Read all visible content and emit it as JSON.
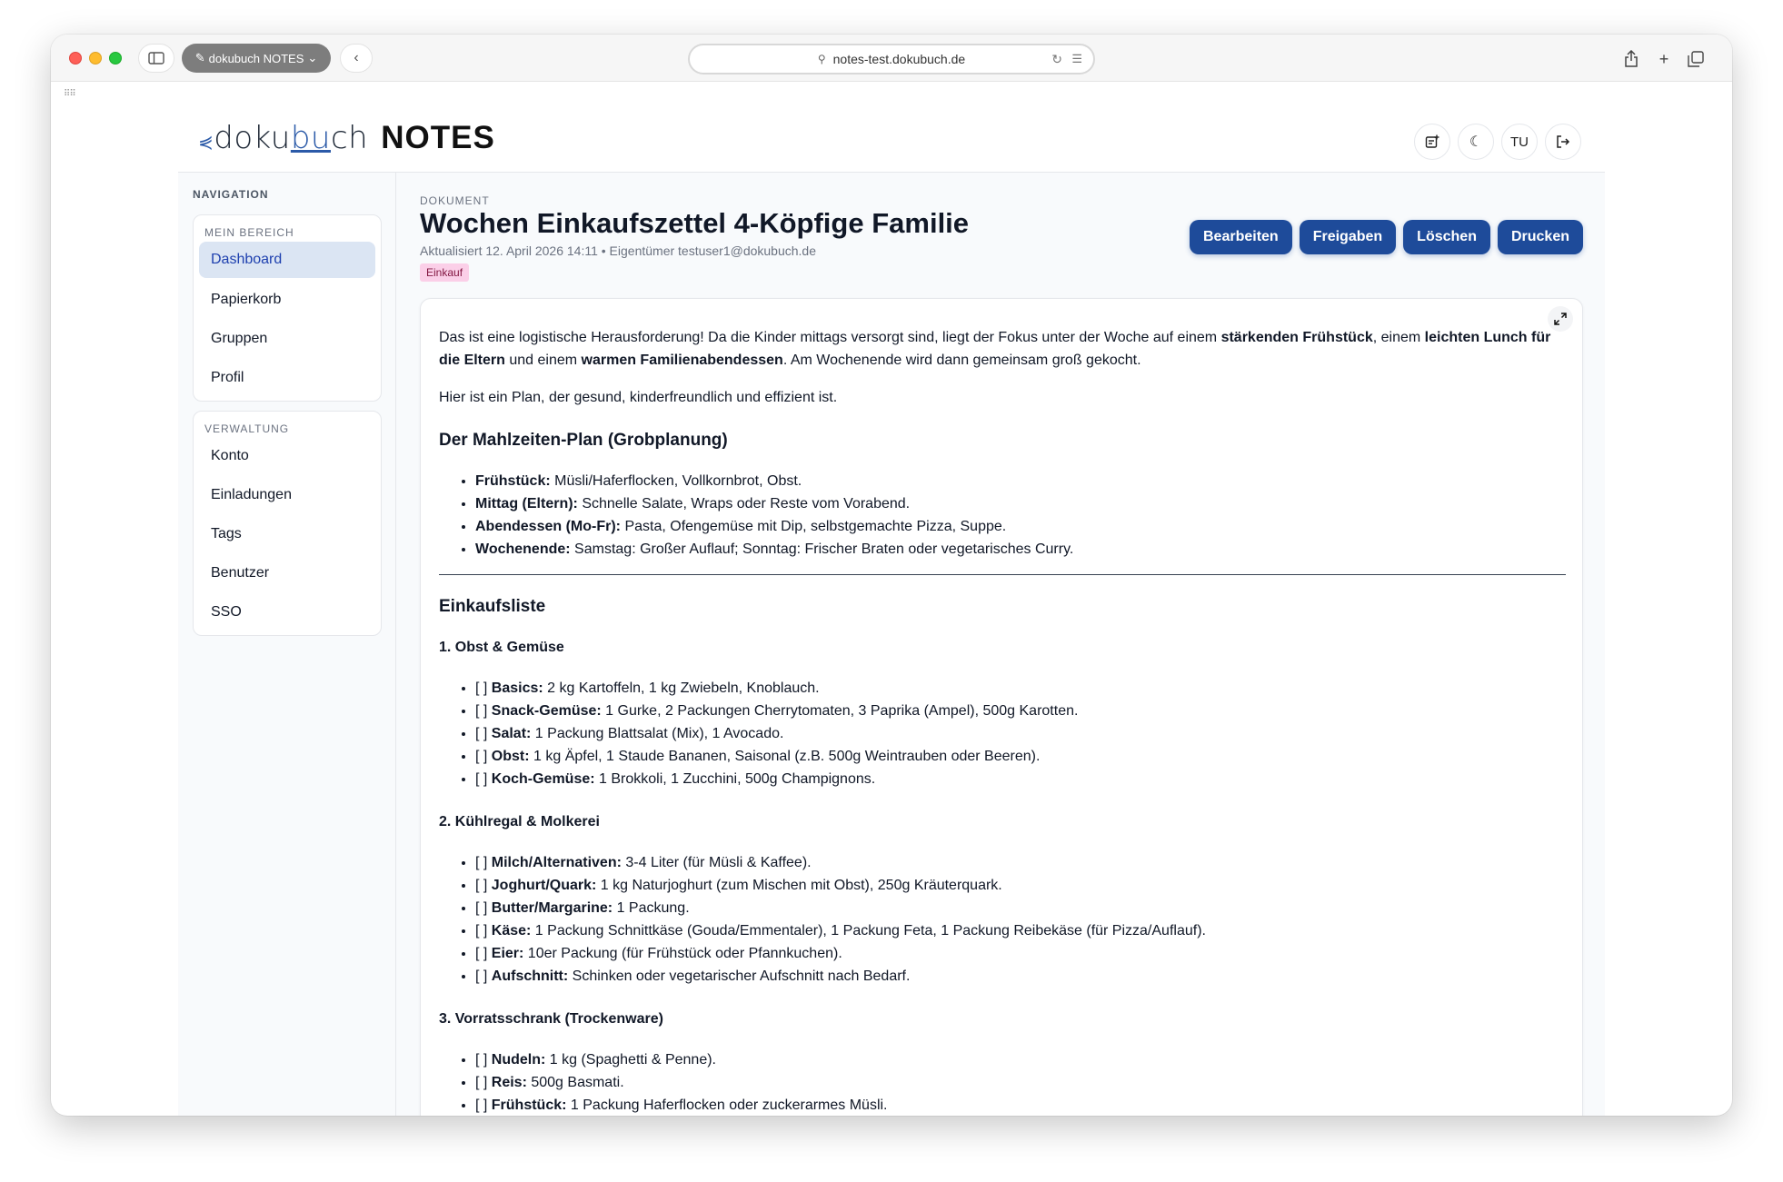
{
  "browser": {
    "tab_group_label": "dokubuch NOTES",
    "url": "notes-test.dokubuch.de"
  },
  "header": {
    "logo_text_pre": "doku",
    "logo_text_mid": "bu",
    "logo_text_post": "ch",
    "logo_product": "NOTES",
    "user_initials": "TU"
  },
  "nav": {
    "title": "NAVIGATION",
    "group1_label": "MEIN BEREICH",
    "group1_items": [
      "Dashboard",
      "Papierkorb",
      "Gruppen",
      "Profil"
    ],
    "group2_label": "VERWALTUNG",
    "group2_items": [
      "Konto",
      "Einladungen",
      "Tags",
      "Benutzer",
      "SSO"
    ]
  },
  "document": {
    "kicker": "DOKUMENT",
    "title": "Wochen Einkaufszettel 4-Köpfige Familie",
    "meta": "Aktualisiert 12. April 2026 14:11 • Eigentümer testuser1@dokubuch.de",
    "tag": "Einkauf",
    "actions": [
      "Bearbeiten",
      "Freigaben",
      "Löschen",
      "Drucken"
    ]
  },
  "content": {
    "intro_a": "Das ist eine logistische Herausforderung! Da die Kinder mittags versorgt sind, liegt der Fokus unter der Woche auf einem ",
    "intro_b": "stärkenden Frühstück",
    "intro_c": ", einem ",
    "intro_d": "leichten Lunch für die Eltern",
    "intro_e": " und einem ",
    "intro_f": "warmen Familienabendessen",
    "intro_g": ". Am Wochenende wird dann gemeinsam groß gekocht.",
    "plan_intro": "Hier ist ein Plan, der gesund, kinderfreundlich und effizient ist.",
    "plan_heading": "Der Mahlzeiten-Plan (Grobplanung)",
    "plan": [
      {
        "k": "Frühstück:",
        "v": " Müsli/Haferflocken, Vollkornbrot, Obst."
      },
      {
        "k": "Mittag (Eltern):",
        "v": " Schnelle Salate, Wraps oder Reste vom Vorabend."
      },
      {
        "k": "Abendessen (Mo-Fr):",
        "v": " Pasta, Ofengemüse mit Dip, selbstgemachte Pizza, Suppe."
      },
      {
        "k": "Wochenende:",
        "v": " Samstag: Großer Auflauf; Sonntag: Frischer Braten oder vegetarisches Curry."
      }
    ],
    "list_heading": "Einkaufsliste",
    "sections": [
      {
        "title": "1. Obst & Gemüse",
        "items": [
          {
            "k": "Basics:",
            "v": " 2 kg Kartoffeln, 1 kg Zwiebeln, Knoblauch."
          },
          {
            "k": "Snack-Gemüse:",
            "v": " 1 Gurke, 2 Packungen Cherrytomaten, 3 Paprika (Ampel), 500g Karotten."
          },
          {
            "k": "Salat:",
            "v": " 1 Packung Blattsalat (Mix), 1 Avocado."
          },
          {
            "k": "Obst:",
            "v": " 1 kg Äpfel, 1 Staude Bananen, Saisonal (z.B. 500g Weintrauben oder Beeren)."
          },
          {
            "k": "Koch-Gemüse:",
            "v": " 1 Brokkoli, 1 Zucchini, 500g Champignons."
          }
        ]
      },
      {
        "title": "2. Kühlregal & Molkerei",
        "items": [
          {
            "k": "Milch/Alternativen:",
            "v": " 3-4 Liter (für Müsli & Kaffee)."
          },
          {
            "k": "Joghurt/Quark:",
            "v": " 1 kg Naturjoghurt (zum Mischen mit Obst), 250g Kräuterquark."
          },
          {
            "k": "Butter/Margarine:",
            "v": " 1 Packung."
          },
          {
            "k": "Käse:",
            "v": " 1 Packung Schnittkäse (Gouda/Emmentaler), 1 Packung Feta, 1 Packung Reibekäse (für Pizza/Auflauf)."
          },
          {
            "k": "Eier:",
            "v": " 10er Packung (für Frühstück oder Pfannkuchen)."
          },
          {
            "k": "Aufschnitt:",
            "v": " Schinken oder vegetarischer Aufschnitt nach Bedarf."
          }
        ]
      },
      {
        "title": "3. Vorratsschrank (Trockenware)",
        "items": [
          {
            "k": "Nudeln:",
            "v": " 1 kg (Spaghetti & Penne)."
          },
          {
            "k": "Reis:",
            "v": " 500g Basmati."
          },
          {
            "k": "Frühstück:",
            "v": " 1 Packung Haferflocken oder zuckerarmes Müsli."
          }
        ]
      }
    ],
    "checkbox": "[ ] "
  }
}
